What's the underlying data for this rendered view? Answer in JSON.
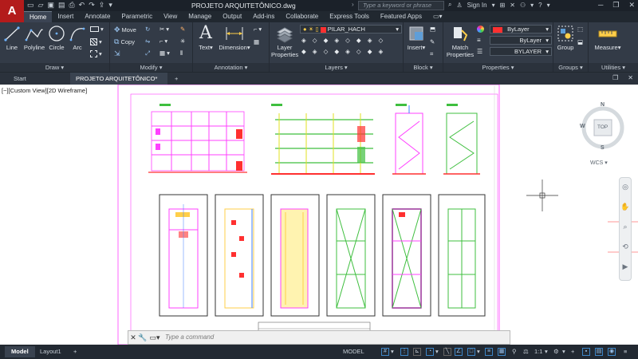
{
  "app": {
    "logo": "A",
    "document_title": "PROJETO ARQUITETÔNICO.dwg",
    "search_placeholder": "Type a keyword or phrase",
    "sign_in": "Sign In"
  },
  "ribbon_tabs": [
    "Home",
    "Insert",
    "Annotate",
    "Parametric",
    "View",
    "Manage",
    "Output",
    "Add-ins",
    "Collaborate",
    "Express Tools",
    "Featured Apps"
  ],
  "ribbon": {
    "draw": {
      "title": "Draw",
      "line": "Line",
      "polyline": "Polyline",
      "circle": "Circle",
      "arc": "Arc"
    },
    "modify": {
      "title": "Modify",
      "move": "Move",
      "copy": "Copy"
    },
    "annotation": {
      "title": "Annotation",
      "text": "Text",
      "dimension": "Dimension"
    },
    "layers": {
      "title": "Layers",
      "layer_properties_line1": "Layer",
      "layer_properties_line2": "Properties",
      "current_layer": "PILAR_HACH"
    },
    "block": {
      "title": "Block",
      "insert": "Insert"
    },
    "properties": {
      "title": "Properties",
      "match_line1": "Match",
      "match_line2": "Properties",
      "color": "ByLayer",
      "linetype": "ByLayer",
      "lineweight": "BYLAYER"
    },
    "groups": {
      "title": "Groups",
      "group": "Group"
    },
    "utilities": {
      "title": "Utilities",
      "measure": "Measure"
    }
  },
  "doc_tabs": {
    "start": "Start",
    "current": "PROJETO ARQUITETÔNICO*",
    "add": "+"
  },
  "viewport": {
    "label": "[−][Custom View][2D Wireframe]"
  },
  "navcube": {
    "n": "N",
    "w": "W",
    "s": "S",
    "e": "E",
    "top": "TOP",
    "wcs": "WCS"
  },
  "command": {
    "placeholder": "Type a command"
  },
  "status": {
    "model_tab": "Model",
    "layout_tab": "Layout1",
    "model_space": "MODEL",
    "scale": "1:1"
  },
  "colors": {
    "accent_red": "#b31b1b",
    "ribbon_bg": "#333b47",
    "active_blue": "#3d85c6"
  }
}
